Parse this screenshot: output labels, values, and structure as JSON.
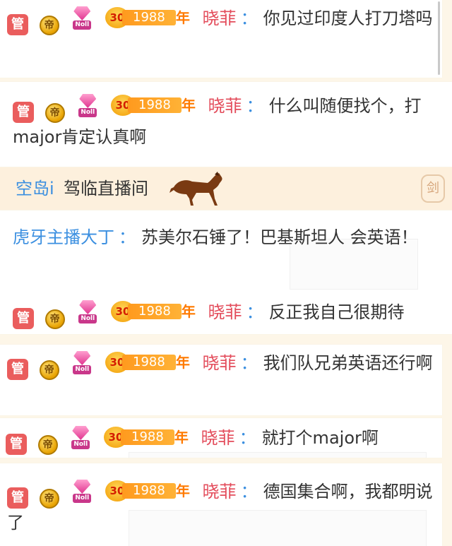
{
  "badges": {
    "admin": "管",
    "coin": "帝",
    "noble_tag": "Noll",
    "fan_level": "30",
    "fan_club": "1988",
    "fan_suffix": "年"
  },
  "messages": [
    {
      "user": "晓菲",
      "colon": "：",
      "text": "你见过印度人打刀塔吗"
    },
    {
      "user": "晓菲",
      "colon": "：",
      "text": "什么叫随便找个，打major肯定认真啊"
    },
    {
      "type": "system",
      "user": "空岛i",
      "text": "驾临直播间",
      "icon": "horse-icon",
      "side_icon": "剑"
    },
    {
      "user": "虎牙主播大丁",
      "colon": "：",
      "text": "苏美尔石锤了！巴基斯坦人 会英语！"
    },
    {
      "user": "晓菲",
      "colon": "：",
      "text": "反正我自己很期待"
    },
    {
      "user": "晓菲",
      "colon": "：",
      "text": "我们队兄弟英语还行啊"
    },
    {
      "user": "晓菲",
      "colon": "：",
      "text": "就打个major啊"
    },
    {
      "user": "晓菲",
      "colon": "：",
      "text": "德国集合啊，我都明说了"
    }
  ],
  "colors": {
    "background": "#fdf6e8",
    "username_red": "#e34c5b",
    "username_blue": "#3b8fe0",
    "admin_red": "#ea5d5d",
    "fan_orange": "#ff9a1e"
  }
}
